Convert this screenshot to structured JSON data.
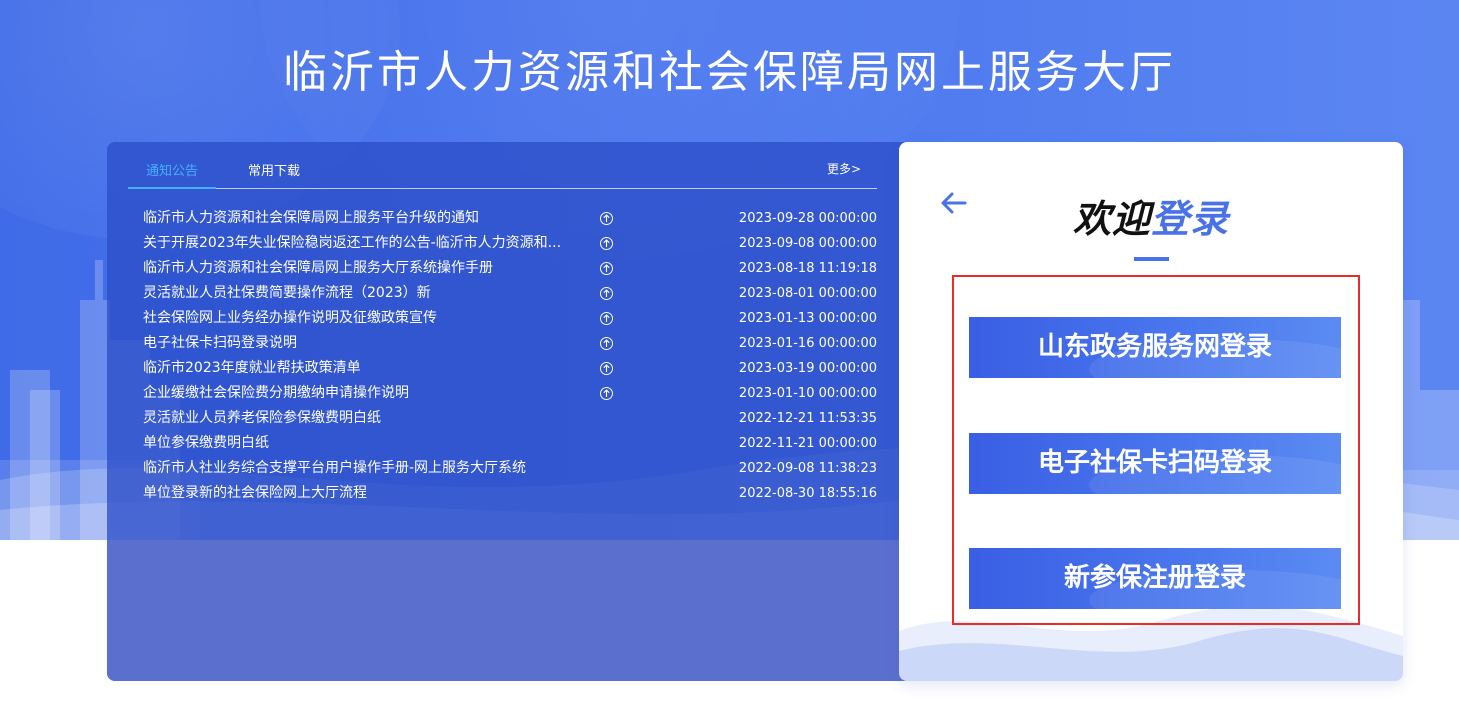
{
  "page": {
    "title": "临沂市人力资源和社会保障局网上服务大厅"
  },
  "notices": {
    "tabs": [
      {
        "label": "通知公告",
        "active": true
      },
      {
        "label": "常用下载",
        "active": false
      }
    ],
    "more_label": "更多>",
    "items": [
      {
        "title": "临沂市人力资源和社会保障局网上服务平台升级的通知",
        "date": "2023-09-28 00:00:00",
        "has_icon": true
      },
      {
        "title": "关于开展2023年失业保险稳岗返还工作的公告-临沂市人力资源和...",
        "date": "2023-09-08 00:00:00",
        "has_icon": true
      },
      {
        "title": "临沂市人力资源和社会保障局网上服务大厅系统操作手册",
        "date": "2023-08-18 11:19:18",
        "has_icon": true
      },
      {
        "title": "灵活就业人员社保费简要操作流程（2023）新",
        "date": "2023-08-01 00:00:00",
        "has_icon": true
      },
      {
        "title": "社会保险网上业务经办操作说明及征缴政策宣传",
        "date": "2023-01-13 00:00:00",
        "has_icon": true
      },
      {
        "title": "电子社保卡扫码登录说明",
        "date": "2023-01-16 00:00:00",
        "has_icon": true
      },
      {
        "title": "临沂市2023年度就业帮扶政策清单",
        "date": "2023-03-19 00:00:00",
        "has_icon": true
      },
      {
        "title": "企业缓缴社会保险费分期缴纳申请操作说明",
        "date": "2023-01-10 00:00:00",
        "has_icon": true
      },
      {
        "title": "灵活就业人员养老保险参保缴费明白纸",
        "date": "2022-12-21 11:53:35",
        "has_icon": false
      },
      {
        "title": "单位参保缴费明白纸",
        "date": "2022-11-21 00:00:00",
        "has_icon": false
      },
      {
        "title": "临沂市人社业务综合支撑平台用户操作手册-网上服务大厅系统",
        "date": "2022-09-08 11:38:23",
        "has_icon": false
      },
      {
        "title": "单位登录新的社会保险网上大厅流程",
        "date": "2022-08-30 18:55:16",
        "has_icon": false
      }
    ],
    "icon": "upload-circle-icon"
  },
  "login": {
    "welcome_part1": "欢迎",
    "welcome_part2": "登录",
    "back_icon": "arrow-left-icon",
    "buttons": [
      {
        "label": "山东政务服务网登录"
      },
      {
        "label": "电子社保卡扫码登录"
      },
      {
        "label": "新参保注册登录"
      }
    ]
  },
  "colors": {
    "accent": "#4a72e8",
    "active_tab": "#45b0ff",
    "highlight_border": "#ee2a24"
  }
}
